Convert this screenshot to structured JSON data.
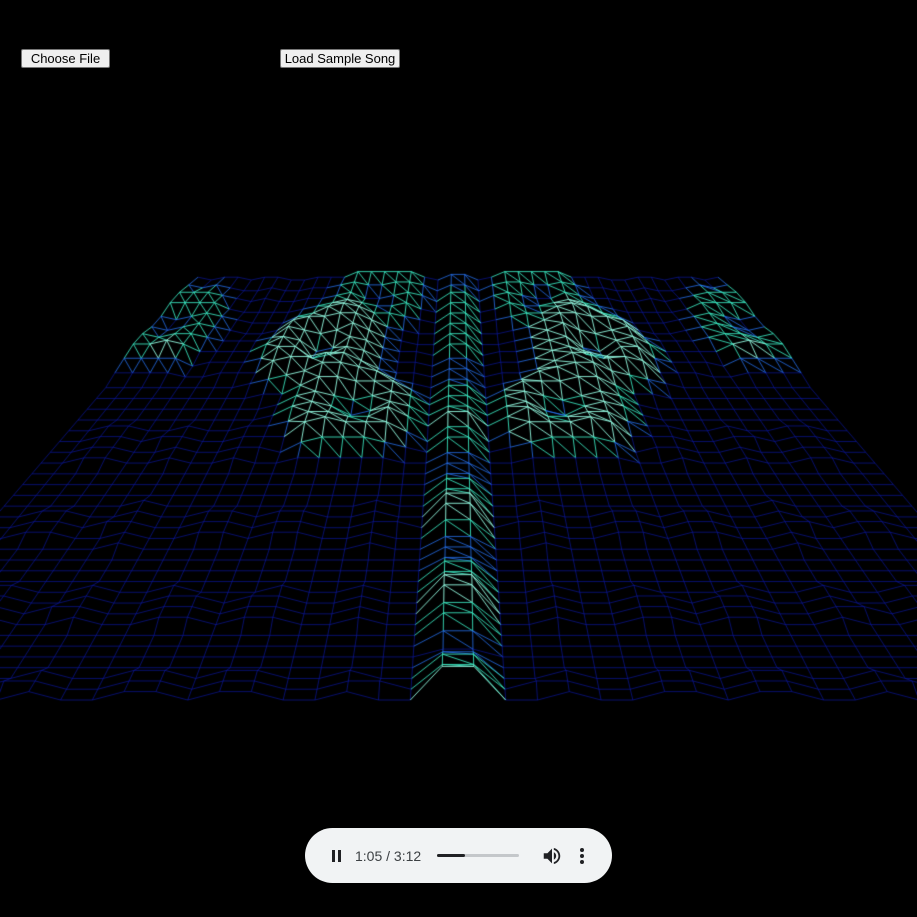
{
  "controls": {
    "choose_file_label": "Choose File",
    "load_sample_label": "Load Sample Song"
  },
  "player": {
    "state": "playing",
    "time_display": "1:05 / 3:12",
    "progress_fraction": 0.339,
    "play_icon": "pause-icon",
    "volume_icon": "volume-icon",
    "menu_icon": "more-vertical-icon"
  },
  "visualizer": {
    "style": "wireframe-terrain",
    "colors": {
      "background": "#000000",
      "low": "#0a14c8",
      "mid": "#1e5aff",
      "high": "#3cf0c8",
      "peak": "#aaffee"
    }
  }
}
